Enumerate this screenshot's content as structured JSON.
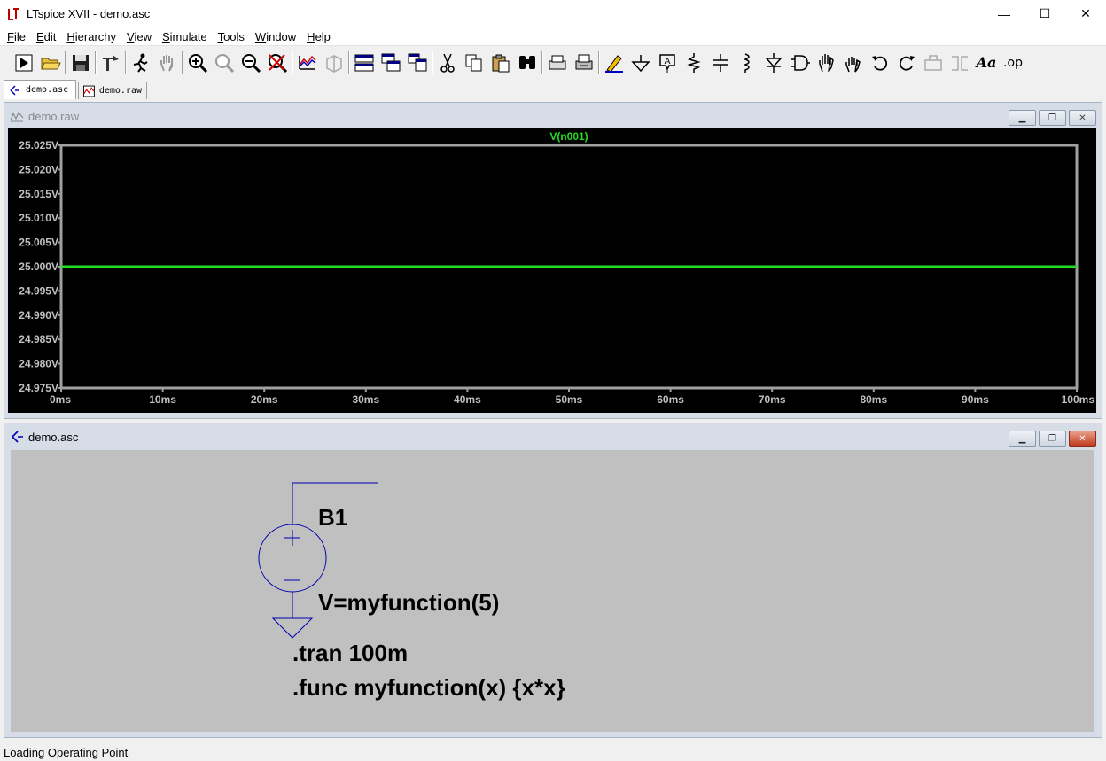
{
  "window": {
    "title": "LTspice XVII - demo.asc",
    "minimize": "—",
    "maximize": "☐",
    "close": "✕"
  },
  "menu": [
    {
      "label": "File",
      "key": "F",
      "rest": "ile"
    },
    {
      "label": "Edit",
      "key": "E",
      "rest": "dit"
    },
    {
      "label": "Hierarchy",
      "key": "H",
      "rest": "ierarchy"
    },
    {
      "label": "View",
      "key": "V",
      "rest": "iew"
    },
    {
      "label": "Simulate",
      "key": "S",
      "rest": "imulate"
    },
    {
      "label": "Tools",
      "key": "T",
      "rest": "ools"
    },
    {
      "label": "Window",
      "key": "W",
      "rest": "indow"
    },
    {
      "label": "Help",
      "key": "H",
      "rest": "elp"
    }
  ],
  "toolbar_icons": [
    "run-icon",
    "open-icon",
    "save-icon",
    "control-panel-icon",
    "halt-icon",
    "pan-icon",
    "zoom-in-icon",
    "zoom-area-icon",
    "zoom-out-icon",
    "zoom-full-icon",
    "autorange-icon",
    "3d-icon",
    "tile-horizontal-icon",
    "cascade-icon",
    "tile-vertical-icon",
    "cut-icon",
    "copy-icon",
    "paste-icon",
    "find-icon",
    "print-setup-icon",
    "print-icon",
    "draw-wire-icon",
    "ground-icon",
    "label-net-icon",
    "resistor-icon",
    "capacitor-icon",
    "inductor-icon",
    "diode-icon",
    "component-icon",
    "move-icon",
    "drag-icon",
    "undo-icon",
    "redo-icon",
    "rotate-icon",
    "mirror-icon",
    "text-icon",
    "spice-directive-icon"
  ],
  "toolbar_text": {
    "text_tool": "Aa",
    "op_tool": ".op"
  },
  "doc_tabs": [
    {
      "label": "demo.asc",
      "active": true
    },
    {
      "label": "demo.raw",
      "active": false
    }
  ],
  "waveform_window": {
    "title": "demo.raw",
    "trace_name": "V(n001)",
    "trace_color": "#22dd22"
  },
  "chart_data": {
    "type": "line",
    "title": "",
    "series": [
      {
        "name": "V(n001)",
        "x": [
          0,
          100
        ],
        "y": [
          25.0,
          25.0
        ]
      }
    ],
    "xlim": [
      0,
      100
    ],
    "ylim": [
      24.975,
      25.025
    ],
    "x_ticks": [
      "0ms",
      "10ms",
      "20ms",
      "30ms",
      "40ms",
      "50ms",
      "60ms",
      "70ms",
      "80ms",
      "90ms",
      "100ms"
    ],
    "y_ticks": [
      "25.025V",
      "25.020V",
      "25.015V",
      "25.010V",
      "25.005V",
      "25.000V",
      "24.995V",
      "24.990V",
      "24.985V",
      "24.980V",
      "24.975V"
    ],
    "y_tick_values": [
      25.025,
      25.02,
      25.015,
      25.01,
      25.005,
      25.0,
      24.995,
      24.99,
      24.985,
      24.98,
      24.975
    ],
    "x_tick_values": [
      0,
      10,
      20,
      30,
      40,
      50,
      60,
      70,
      80,
      90,
      100
    ],
    "grid": false,
    "background": "#000000",
    "axis_color": "#a0a0a0",
    "label_color": "#c0c0c0"
  },
  "schematic_window": {
    "title": "demo.asc",
    "component_name": "B1",
    "component_value": "V=myfunction(5)",
    "directives": [
      ".tran 100m",
      ".func myfunction(x) {x*x}"
    ],
    "wire_color": "#0000b0"
  },
  "status": {
    "text": "Loading Operating Point"
  }
}
